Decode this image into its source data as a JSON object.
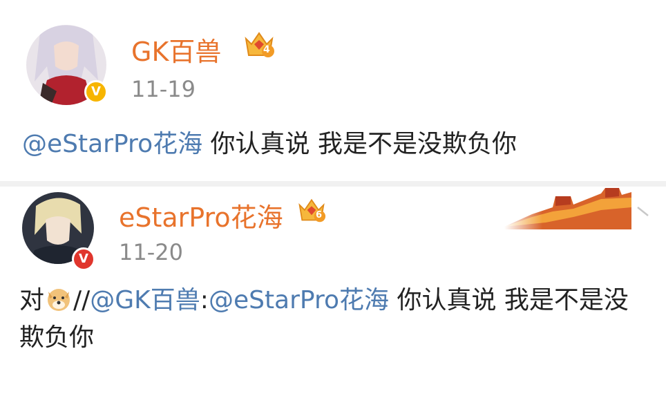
{
  "posts": [
    {
      "username": "GK百兽",
      "level": "4",
      "time": "11-19",
      "verified_badge": "V",
      "badge_color": "#f7b500",
      "mention": "@eStarPro花海",
      "text": " 你认真说 我是不是没欺负你"
    },
    {
      "username": "eStarPro花海",
      "level": "6",
      "time": "11-20",
      "verified_badge": "V",
      "badge_color": "#e0362d",
      "reply_prefix": "对",
      "emoji": "doge-emoji",
      "slashes": "//",
      "mention1": "@GK百兽",
      "colon": ":",
      "mention2": "@eStarPro花海",
      "text": " 你认真说 我是不是没欺负你"
    }
  ],
  "colors": {
    "username": "#e8732c",
    "mention": "#4e7bb0",
    "time": "#8a8a8a"
  },
  "icons": [
    "crown-icon",
    "verified-icon",
    "great-wall-decoration",
    "chevron-down-icon"
  ]
}
